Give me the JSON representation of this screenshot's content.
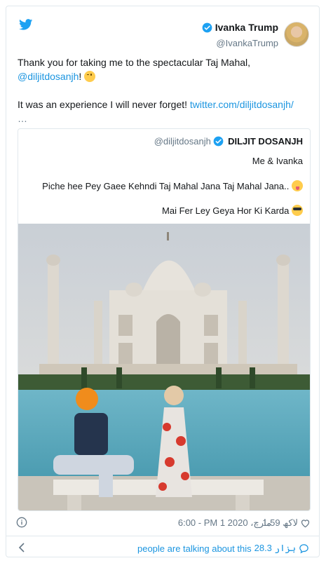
{
  "colors": {
    "link": "#1b95e0",
    "text": "#14171a",
    "muted": "#657786",
    "border": "#e1e8ed",
    "twitter_blue": "#1da1f2"
  },
  "icons": {
    "brand": "twitter-bird-icon",
    "verified": "verified-badge-icon",
    "info": "info-icon",
    "like": "heart-icon",
    "back": "chevron-left-icon",
    "reply": "speech-bubble-icon"
  },
  "author": {
    "name": "Ivanka Trump",
    "handle": "@IvankaTrump"
  },
  "tweet": {
    "line1": "Thank you for taking me to the spectacular Taj Mahal,",
    "mention": "@diljitdosanjh",
    "after_mention": "!",
    "line2": "It was an experience I will never forget!",
    "link": "twitter.com/diljitdosanjh/",
    "ellipsis": "…"
  },
  "quoted": {
    "handle": "@diljitdosanjh",
    "name": "DILJIT DOSANJH",
    "line1": "Me & Ivanka",
    "line2": "Piche hee Pey Gaee Kehndi Taj Mahal Jana Taj Mahal Jana..",
    "line3": "Mai Fer Ley Geya Hor Ki Karda"
  },
  "meta": {
    "timestamp": "6:00 - PM 1 مارچ، 2020",
    "likes": "1.59 لاکھ"
  },
  "footer": {
    "talking_count": "28.3 ہزار",
    "talking_label": "people are talking about this"
  }
}
